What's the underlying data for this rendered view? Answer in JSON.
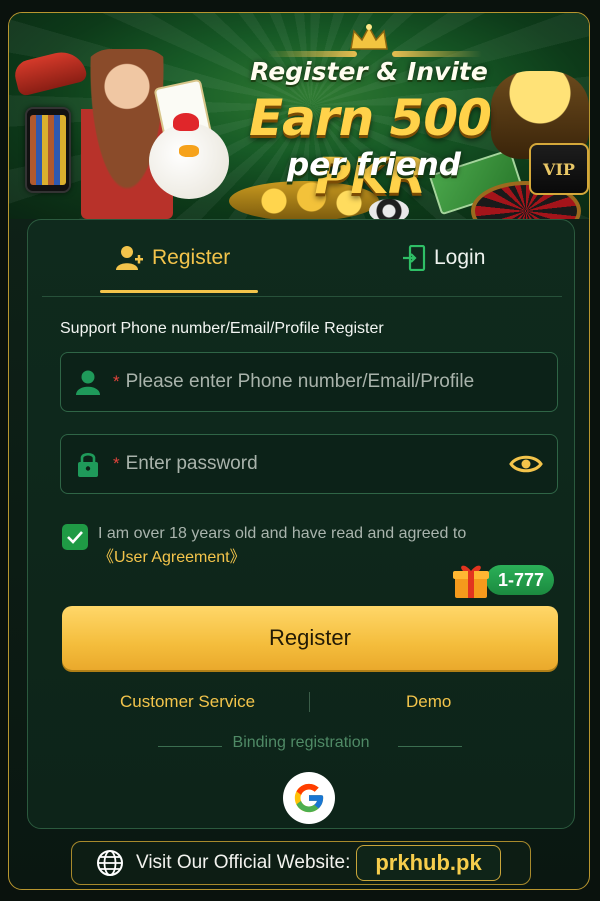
{
  "banner": {
    "title": "Register & Invite",
    "headline": "Earn 500 PKR",
    "subline": "per friend",
    "vip_label": "VIP"
  },
  "tabs": {
    "register_label": "Register",
    "login_label": "Login",
    "active": "register"
  },
  "form": {
    "support_text": "Support Phone number/Email/Profile Register",
    "account": {
      "placeholder": "Please enter Phone number/Email/Profile",
      "value": ""
    },
    "password": {
      "placeholder": "Enter password",
      "value": ""
    },
    "required_mark": "*",
    "agreement": {
      "checked": true,
      "text": "I am over 18 years old and have read and agreed to",
      "link_text": "《User Agreement》"
    },
    "bonus_badge": "1-777",
    "submit_label": "Register"
  },
  "links": {
    "customer_service": "Customer Service",
    "demo": "Demo"
  },
  "binding_label": "Binding registration",
  "social": [
    {
      "name": "google-icon"
    }
  ],
  "footer": {
    "visit_label": "Visit Our Official Website:",
    "site": "prkhub.pk"
  },
  "colors": {
    "accent": "#f3c44b",
    "background": "#0d2419",
    "success": "#1f9a45",
    "required": "#e2443c"
  }
}
